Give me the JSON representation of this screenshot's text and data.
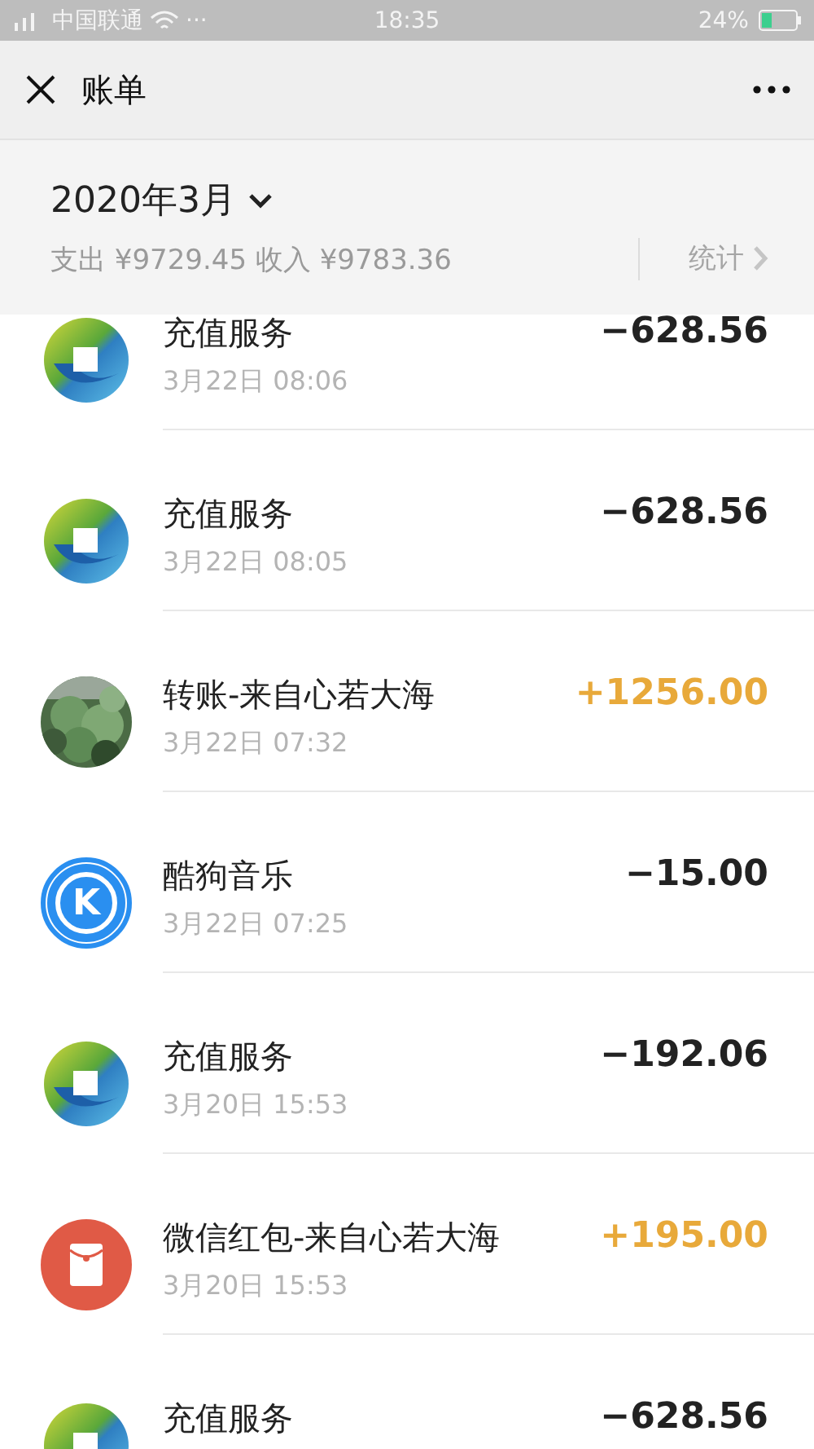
{
  "status_bar": {
    "carrier": "中国联通",
    "dots": "···",
    "time": "18:35",
    "battery": "24%"
  },
  "header": {
    "title": "账单"
  },
  "summary": {
    "month": "2020年3月",
    "totals": "支出 ¥9729.45 收入 ¥9783.36",
    "stats": "统计"
  },
  "transactions": [
    {
      "icon": {
        "kind": "bank"
      },
      "title": "充值服务",
      "date": "3月22日 08:06",
      "amount": "−628.56",
      "kind": "expense"
    },
    {
      "icon": {
        "kind": "bank"
      },
      "title": "充值服务",
      "date": "3月22日 08:05",
      "amount": "−628.56",
      "kind": "expense"
    },
    {
      "title": "转账-来自心若大海",
      "date": "3月22日 07:32",
      "amount": "+1256.00",
      "kind": "income"
    },
    {
      "icon": {
        "kind": "letter",
        "letter": "K"
      },
      "title": "酷狗音乐",
      "date": "3月22日 07:25",
      "amount": "−15.00",
      "kind": "expense"
    },
    {
      "icon": {
        "kind": "bank"
      },
      "title": "充值服务",
      "date": "3月20日 15:53",
      "amount": "−192.06",
      "kind": "expense"
    },
    {
      "icon": {
        "kind": "envelope"
      },
      "title": "微信红包-来自心若大海",
      "date": "3月20日 15:53",
      "amount": "+195.00",
      "kind": "income"
    },
    {
      "icon": {
        "kind": "bank"
      },
      "title": "充值服务",
      "amount": "−628.56",
      "kind": "expense"
    }
  ]
}
